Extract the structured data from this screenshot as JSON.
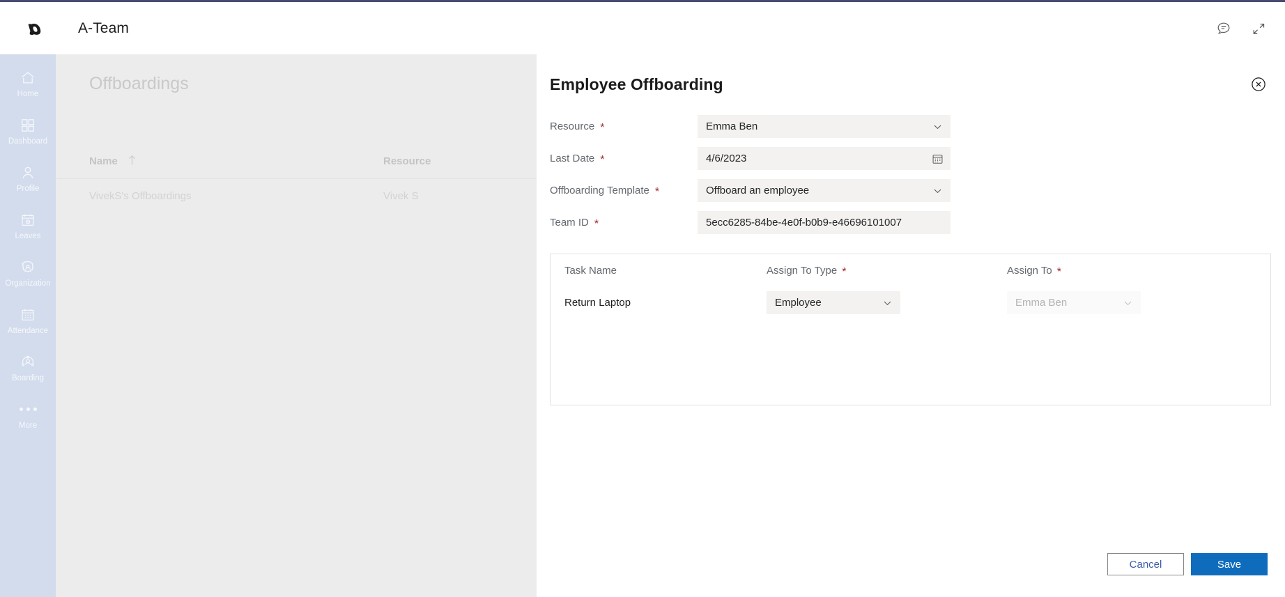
{
  "topbar": {
    "app_title": "A-Team",
    "logo_icon": "a-team-logo-icon",
    "feedback_icon": "chat-bubble-icon",
    "collapse_icon": "collapse-diagonal-arrows-icon"
  },
  "sidebar": {
    "items": [
      {
        "label": "Home",
        "icon": "home-icon"
      },
      {
        "label": "Dashboard",
        "icon": "dashboard-grid-icon"
      },
      {
        "label": "Profile",
        "icon": "person-icon"
      },
      {
        "label": "Leaves",
        "icon": "calendar-cancel-icon"
      },
      {
        "label": "Organization",
        "icon": "org-gear-people-icon"
      },
      {
        "label": "Attendance",
        "icon": "calendar-dots-icon"
      },
      {
        "label": "Boarding",
        "icon": "person-circle-arrows-icon"
      },
      {
        "label": "More",
        "icon": "ellipsis-icon"
      }
    ]
  },
  "background_page": {
    "heading": "Offboardings",
    "table": {
      "columns": [
        {
          "label": "Name",
          "sort_icon": "sort-ascending-arrow-icon"
        },
        {
          "label": "Resource"
        }
      ],
      "rows": [
        {
          "name": "VivekS's Offboardings",
          "resource": "Vivek S"
        }
      ]
    }
  },
  "dialog": {
    "title": "Employee Offboarding",
    "close_icon": "close-circle-icon",
    "fields": [
      {
        "label": "Resource",
        "required": true,
        "value": "Emma Ben",
        "control": "dropdown",
        "icon": "chevron-down-icon"
      },
      {
        "label": "Last Date",
        "required": true,
        "value": "4/6/2023",
        "control": "date",
        "icon": "calendar-icon"
      },
      {
        "label": "Offboarding Template",
        "required": true,
        "value": "Offboard an employee",
        "control": "dropdown",
        "icon": "chevron-down-icon"
      },
      {
        "label": "Team ID",
        "required": true,
        "value": "5ecc6285-84be-4e0f-b0b9-e46696101007",
        "control": "text",
        "icon": ""
      }
    ],
    "task_table": {
      "columns": [
        {
          "label": "Task Name",
          "required": false
        },
        {
          "label": "Assign To Type",
          "required": true
        },
        {
          "label": "Assign To",
          "required": true
        }
      ],
      "rows": [
        {
          "task_name": "Return Laptop",
          "assign_to_type": "Employee",
          "assign_to": "Emma Ben",
          "assign_to_disabled": true
        }
      ]
    },
    "buttons": {
      "cancel": "Cancel",
      "save": "Save"
    }
  },
  "colors": {
    "accent": "#0f6cbd",
    "rail": "#d2dced",
    "required": "#a4262c",
    "topborder": "#484b6f"
  }
}
